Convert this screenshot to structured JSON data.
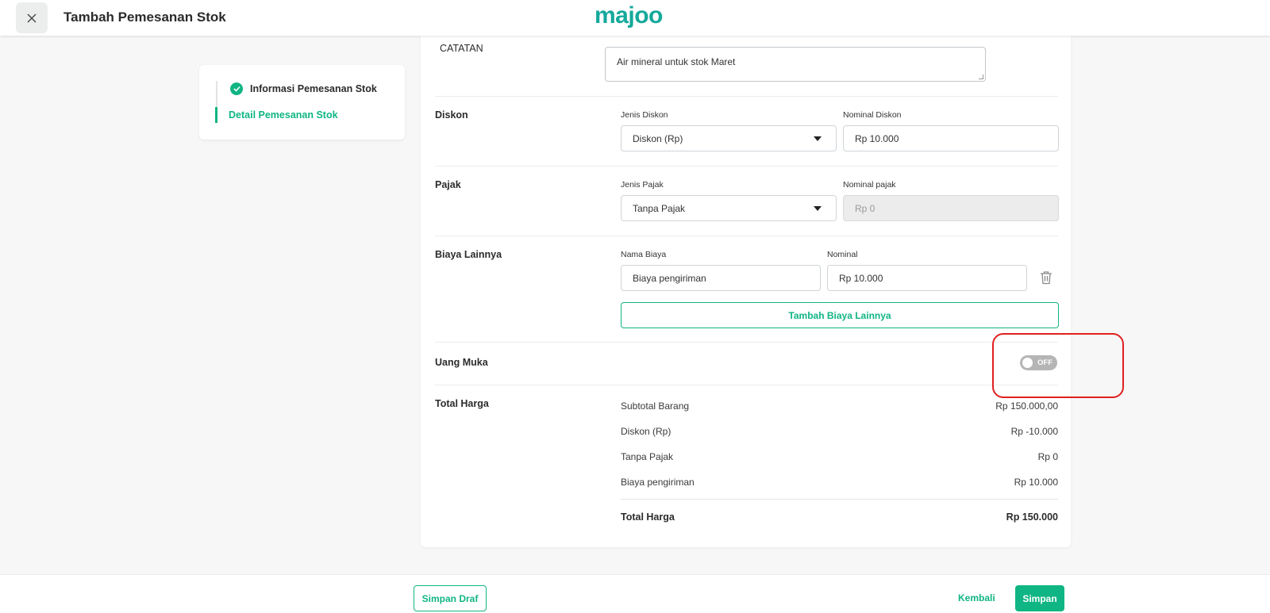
{
  "header": {
    "title": "Tambah Pemesanan Stok",
    "logo": "majoo"
  },
  "stepper": {
    "steps": [
      {
        "label": "Informasi Pemesanan Stok",
        "state": "completed"
      },
      {
        "label": "Detail Pemesanan Stok",
        "state": "active"
      }
    ]
  },
  "form": {
    "catatan": {
      "label": "CATATAN",
      "value": "Air mineral untuk stok Maret"
    },
    "diskon": {
      "label": "Diskon",
      "jenis_label": "Jenis Diskon",
      "jenis_value": "Diskon (Rp)",
      "nominal_label": "Nominal Diskon",
      "nominal_value": "Rp 10.000"
    },
    "pajak": {
      "label": "Pajak",
      "jenis_label": "Jenis Pajak",
      "jenis_value": "Tanpa Pajak",
      "nominal_label": "Nominal pajak",
      "nominal_value": "Rp 0"
    },
    "biaya": {
      "label": "Biaya Lainnya",
      "nama_label": "Nama Biaya",
      "nama_value": "Biaya pengiriman",
      "nominal_label": "Nominal",
      "nominal_value": "Rp 10.000",
      "add_button": "Tambah Biaya Lainnya"
    },
    "uang_muka": {
      "label": "Uang Muka",
      "toggle_text": "OFF",
      "enabled": false
    },
    "total": {
      "label": "Total Harga",
      "rows": [
        {
          "label": "Subtotal Barang",
          "value": "Rp 150.000,00"
        },
        {
          "label": "Diskon (Rp)",
          "value": "Rp -10.000"
        },
        {
          "label": "Tanpa Pajak",
          "value": "Rp 0"
        },
        {
          "label": "Biaya pengiriman",
          "value": "Rp 10.000"
        }
      ],
      "grand_label": "Total Harga",
      "grand_value": "Rp 150.000"
    }
  },
  "footer": {
    "draft": "Simpan Draf",
    "back": "Kembali",
    "save": "Simpan"
  },
  "colors": {
    "accent": "#10b584",
    "highlight": "#e02020"
  }
}
